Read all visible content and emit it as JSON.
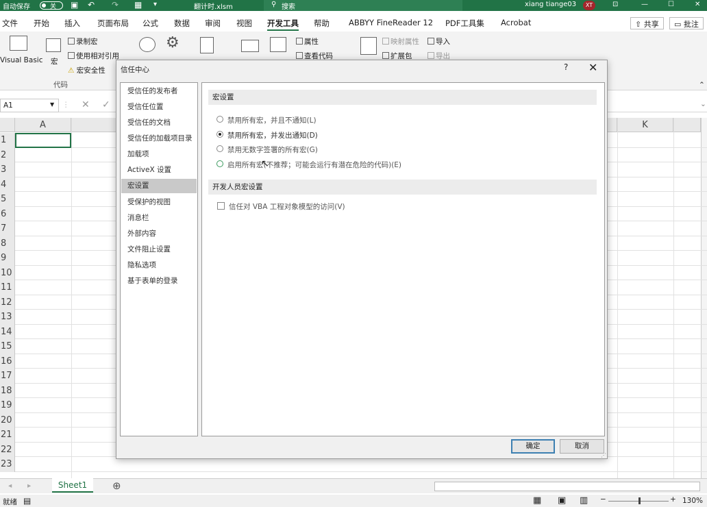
{
  "titlebar": {
    "autosave_label": "自动保存",
    "autosave_state": "关",
    "file_name": "翻计时.xlsm",
    "search_placeholder": "搜索",
    "user_name": "xiang tiange03",
    "user_initials": "XT"
  },
  "menu": {
    "items": [
      "文件",
      "开始",
      "插入",
      "页面布局",
      "公式",
      "数据",
      "审阅",
      "视图",
      "开发工具",
      "帮助",
      "ABBYY FineReader 12",
      "PDF工具集",
      "Acrobat"
    ],
    "active": "开发工具",
    "share_label": "共享",
    "comment_label": "批注"
  },
  "ribbon": {
    "visual_basic": "Visual Basic",
    "macros": "宏",
    "record_macro": "录制宏",
    "relative_ref": "使用相对引用",
    "macro_security": "宏安全性",
    "code_group": "代码",
    "properties": "属性",
    "view_code": "查看代码",
    "map_properties": "映射属性",
    "import": "导入",
    "expansion_packs": "扩展包",
    "export": "导出"
  },
  "formula_bar": {
    "name_box": "A1"
  },
  "grid": {
    "columns": [
      "A",
      "K"
    ],
    "rows": [
      "1",
      "2",
      "3",
      "4",
      "5",
      "6",
      "7",
      "8",
      "9",
      "10",
      "11",
      "12",
      "13",
      "14",
      "15",
      "16",
      "17",
      "18",
      "19",
      "20",
      "21",
      "22",
      "23"
    ]
  },
  "sheets": {
    "active": "Sheet1"
  },
  "status": {
    "ready": "就绪",
    "zoom": "130%"
  },
  "dialog": {
    "title": "信任中心",
    "help": "?",
    "close": "✕",
    "nav": [
      "受信任的发布者",
      "受信任位置",
      "受信任的文档",
      "受信任的加载项目录",
      "加载项",
      "ActiveX 设置",
      "宏设置",
      "受保护的视图",
      "消息栏",
      "外部内容",
      "文件阻止设置",
      "隐私选项",
      "基于表单的登录"
    ],
    "selected_nav": "宏设置",
    "section_macro": "宏设置",
    "options": [
      "禁用所有宏，并且不通知(L)",
      "禁用所有宏，并发出通知(D)",
      "禁用无数字签署的所有宏(G)",
      "启用所有宏(不推荐；可能会运行有潜在危险的代码)(E)"
    ],
    "selected_option": 1,
    "section_dev": "开发人员宏设置",
    "vba_access": "信任对 VBA 工程对象模型的访问(V)",
    "ok": "确定",
    "cancel": "取消"
  }
}
